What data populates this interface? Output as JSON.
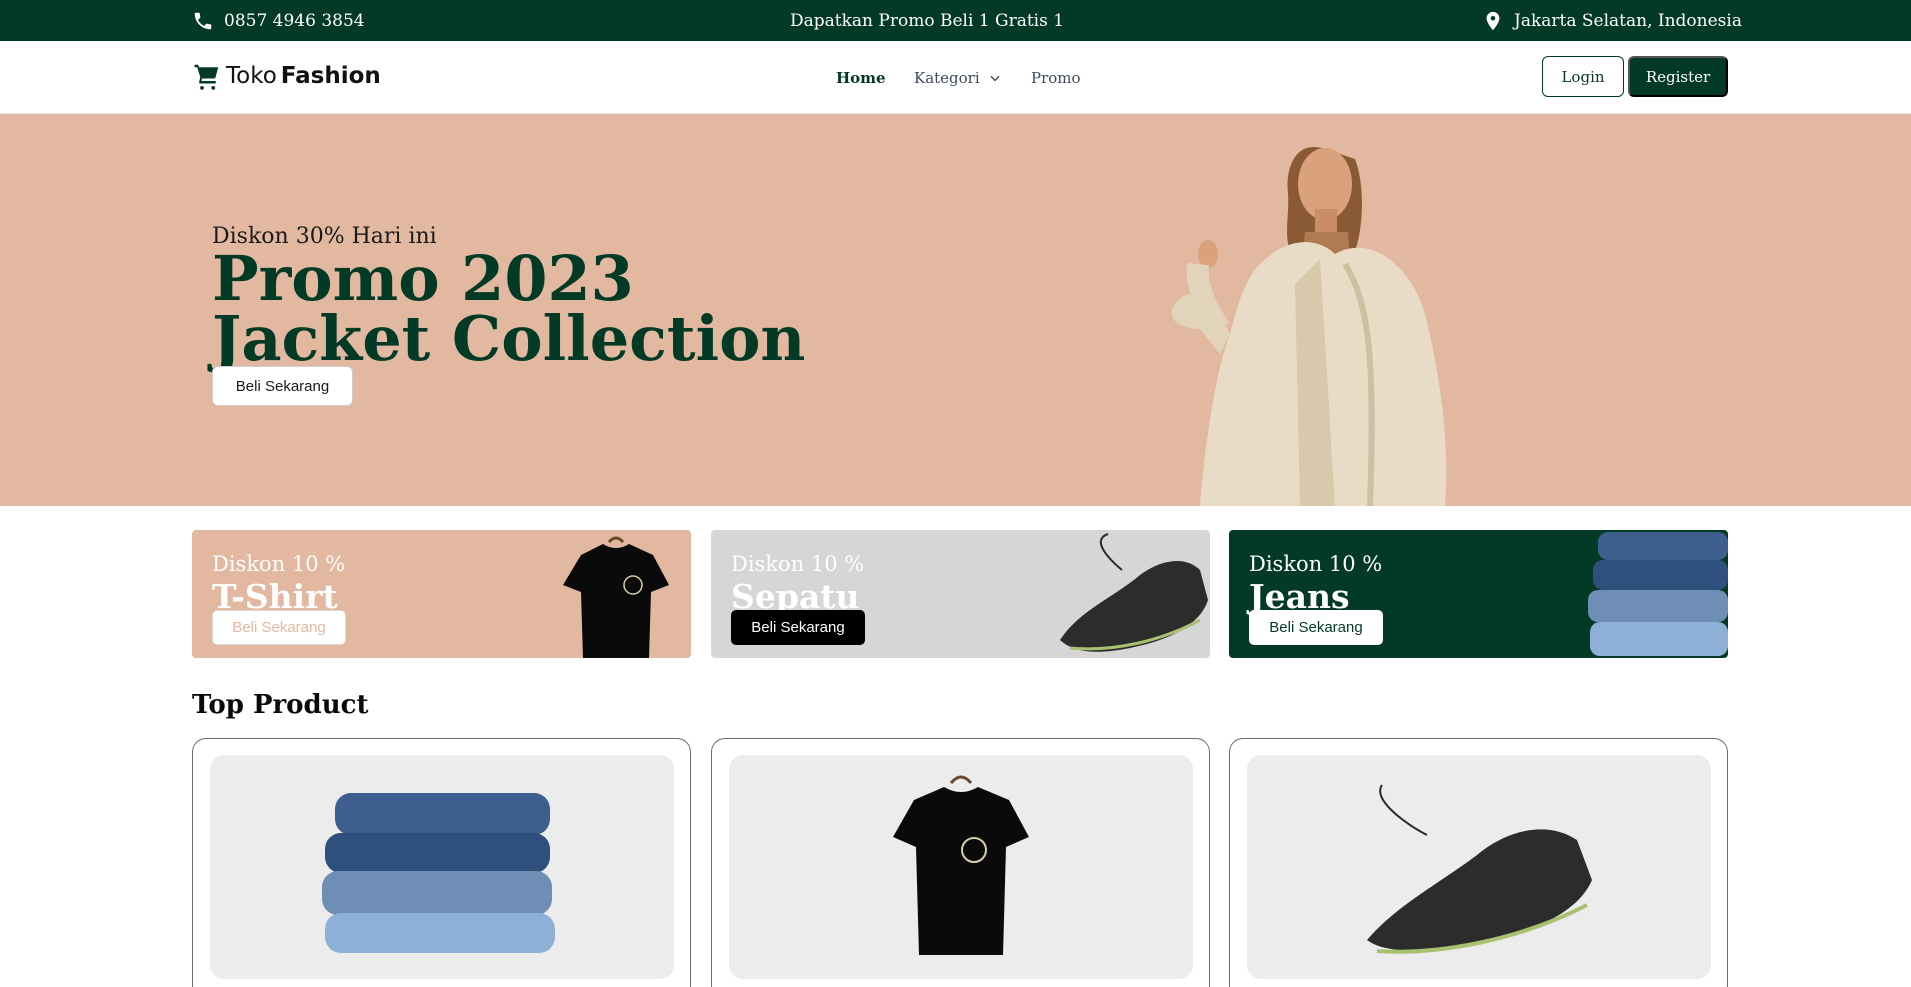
{
  "topbar": {
    "phone": "0857 4946 3854",
    "promo": "Dapatkan Promo Beli 1 Gratis 1",
    "location": "Jakarta Selatan, Indonesia",
    "icons": [
      "phone-icon",
      "location-pin-icon"
    ]
  },
  "nav": {
    "logo_light": "Toko",
    "logo_bold": "Fashion",
    "logo_icon": "cart-icon",
    "items": [
      {
        "label": "Home",
        "active": true
      },
      {
        "label": "Kategori",
        "has_dropdown": true
      },
      {
        "label": "Promo"
      }
    ],
    "login": "Login",
    "register": "Register"
  },
  "hero": {
    "subtitle": "Diskon 30% Hari ini",
    "title_line1": "Promo 2023",
    "title_line2": "Jacket Collection",
    "cta": "Beli Sekarang",
    "image": "woman-in-fur-coat"
  },
  "promos": [
    {
      "discount": "Diskon 10 %",
      "name": "T-Shirt",
      "cta": "Beli Sekarang",
      "bg": "#e3b8a0",
      "button_bg": "#ffffff",
      "button_text": "#e3b8a0",
      "image": "black-tshirt"
    },
    {
      "discount": "Diskon 10 %",
      "name": "Sepatu",
      "cta": "Beli Sekarang",
      "bg": "#d6d6d6",
      "button_bg": "#000000",
      "button_text": "#ffffff",
      "image": "black-sneaker"
    },
    {
      "discount": "Diskon 10 %",
      "name": "Jeans",
      "cta": "Beli Sekarang",
      "bg": "#033a26",
      "button_bg": "#ffffff",
      "button_text": "#033a26",
      "image": "folded-jeans"
    }
  ],
  "top_product": {
    "title": "Top Product",
    "products": [
      {
        "image": "folded-jeans"
      },
      {
        "image": "black-tshirt"
      },
      {
        "image": "black-sneaker"
      }
    ]
  },
  "colors": {
    "primary": "#033a26",
    "peach": "#e3b8a0",
    "gray": "#d6d6d6",
    "card_bg": "#ececec"
  }
}
